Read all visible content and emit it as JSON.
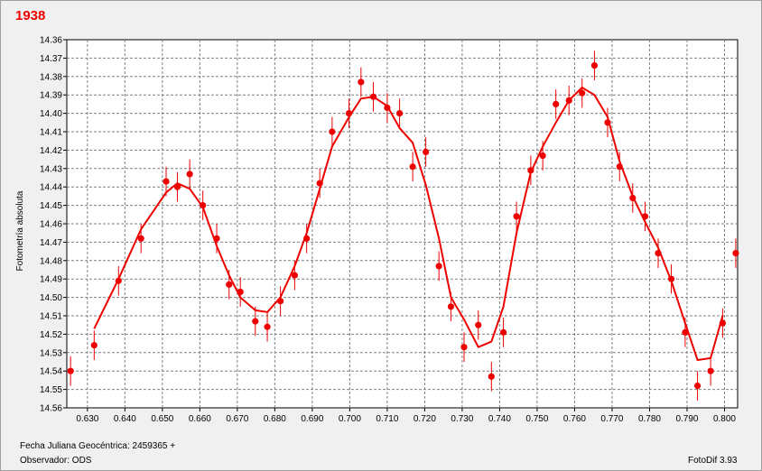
{
  "title": "1938",
  "footer": {
    "jd_label": "Fecha Juliana Geocéntrica: 2459365 +",
    "observer_label": "Observador: ODS",
    "software": "FotoDif 3.93"
  },
  "colors": {
    "series": "#ee0000",
    "title": "#ee0000",
    "grid": "#808080",
    "plot_bg": "#ffffff",
    "window_bg": "#f0f0f0"
  },
  "chart_data": {
    "type": "scatter",
    "title": "1938",
    "xlabel": "Fecha Juliana Geocéntrica: 2459365 +",
    "ylabel": "Fotometría absoluta",
    "xlim": [
      0.6245,
      0.8035
    ],
    "ylim": [
      14.36,
      14.56
    ],
    "y_inverted": true,
    "grid": true,
    "x_ticks": [
      "0.630",
      "0.640",
      "0.650",
      "0.660",
      "0.670",
      "0.680",
      "0.690",
      "0.700",
      "0.710",
      "0.720",
      "0.730",
      "0.740",
      "0.750",
      "0.760",
      "0.770",
      "0.780",
      "0.790",
      "0.800"
    ],
    "y_ticks": [
      "14.36",
      "14.37",
      "14.38",
      "14.39",
      "14.40",
      "14.41",
      "14.42",
      "14.43",
      "14.44",
      "14.45",
      "14.46",
      "14.47",
      "14.48",
      "14.49",
      "14.50",
      "14.51",
      "14.52",
      "14.53",
      "14.54",
      "14.55",
      "14.56"
    ],
    "series": [
      {
        "kind": "points_with_errorbars",
        "err": 0.008,
        "points": [
          [
            0.6255,
            14.54
          ],
          [
            0.6318,
            14.526
          ],
          [
            0.6383,
            14.491
          ],
          [
            0.6443,
            14.468
          ],
          [
            0.651,
            14.437
          ],
          [
            0.654,
            14.44
          ],
          [
            0.6573,
            14.433
          ],
          [
            0.6608,
            14.45
          ],
          [
            0.6645,
            14.468
          ],
          [
            0.6678,
            14.493
          ],
          [
            0.6708,
            14.497
          ],
          [
            0.6748,
            14.513
          ],
          [
            0.678,
            14.516
          ],
          [
            0.6815,
            14.502
          ],
          [
            0.6853,
            14.488
          ],
          [
            0.6885,
            14.468
          ],
          [
            0.692,
            14.438
          ],
          [
            0.6953,
            14.41
          ],
          [
            0.6998,
            14.4
          ],
          [
            0.703,
            14.383
          ],
          [
            0.7063,
            14.391
          ],
          [
            0.71,
            14.397
          ],
          [
            0.7133,
            14.4
          ],
          [
            0.7168,
            14.429
          ],
          [
            0.7203,
            14.421
          ],
          [
            0.7238,
            14.483
          ],
          [
            0.727,
            14.505
          ],
          [
            0.7305,
            14.527
          ],
          [
            0.7343,
            14.515
          ],
          [
            0.7378,
            14.543
          ],
          [
            0.741,
            14.519
          ],
          [
            0.7445,
            14.456
          ],
          [
            0.7483,
            14.431
          ],
          [
            0.7515,
            14.423
          ],
          [
            0.755,
            14.395
          ],
          [
            0.7585,
            14.393
          ],
          [
            0.762,
            14.389
          ],
          [
            0.7653,
            14.374
          ],
          [
            0.7688,
            14.405
          ],
          [
            0.772,
            14.429
          ],
          [
            0.7755,
            14.446
          ],
          [
            0.7788,
            14.456
          ],
          [
            0.7823,
            14.476
          ],
          [
            0.7858,
            14.49
          ],
          [
            0.7895,
            14.519
          ],
          [
            0.7928,
            14.548
          ],
          [
            0.7963,
            14.54
          ],
          [
            0.7995,
            14.514
          ],
          [
            0.803,
            14.476
          ]
        ]
      },
      {
        "kind": "fit_line",
        "points": [
          [
            0.6318,
            14.517
          ],
          [
            0.6383,
            14.49
          ],
          [
            0.6443,
            14.463
          ],
          [
            0.651,
            14.443
          ],
          [
            0.654,
            14.438
          ],
          [
            0.6573,
            14.441
          ],
          [
            0.6608,
            14.451
          ],
          [
            0.6645,
            14.472
          ],
          [
            0.6678,
            14.488
          ],
          [
            0.6708,
            14.5
          ],
          [
            0.6748,
            14.507
          ],
          [
            0.678,
            14.508
          ],
          [
            0.6815,
            14.5
          ],
          [
            0.6853,
            14.483
          ],
          [
            0.6885,
            14.465
          ],
          [
            0.692,
            14.441
          ],
          [
            0.6953,
            14.418
          ],
          [
            0.6998,
            14.402
          ],
          [
            0.703,
            14.392
          ],
          [
            0.7063,
            14.391
          ],
          [
            0.71,
            14.396
          ],
          [
            0.7133,
            14.408
          ],
          [
            0.7168,
            14.416
          ],
          [
            0.7203,
            14.439
          ],
          [
            0.7238,
            14.468
          ],
          [
            0.727,
            14.5
          ],
          [
            0.7305,
            14.512
          ],
          [
            0.7343,
            14.527
          ],
          [
            0.7378,
            14.524
          ],
          [
            0.741,
            14.505
          ],
          [
            0.7445,
            14.465
          ],
          [
            0.7483,
            14.432
          ],
          [
            0.7515,
            14.418
          ],
          [
            0.755,
            14.405
          ],
          [
            0.7585,
            14.393
          ],
          [
            0.762,
            14.386
          ],
          [
            0.7653,
            14.39
          ],
          [
            0.7688,
            14.402
          ],
          [
            0.772,
            14.426
          ],
          [
            0.7755,
            14.445
          ],
          [
            0.7788,
            14.459
          ],
          [
            0.7823,
            14.473
          ],
          [
            0.7858,
            14.491
          ],
          [
            0.7895,
            14.514
          ],
          [
            0.7928,
            14.534
          ],
          [
            0.7963,
            14.533
          ],
          [
            0.7995,
            14.51
          ]
        ]
      }
    ]
  }
}
